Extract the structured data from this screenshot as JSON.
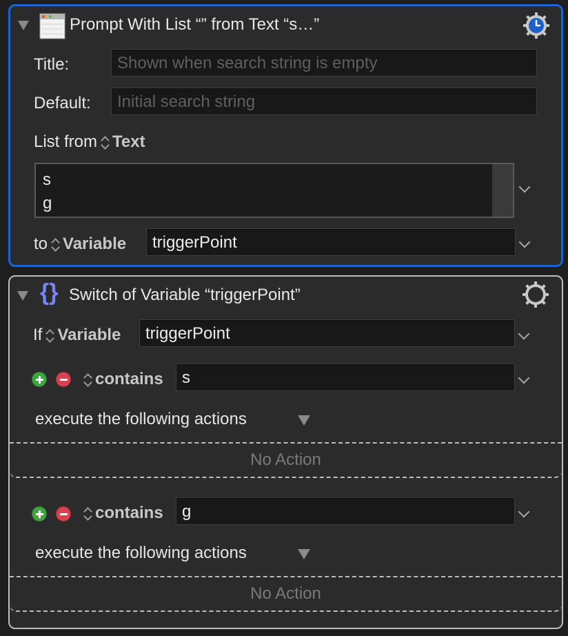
{
  "prompt_action": {
    "title": "Prompt With List “” from Text “s…”",
    "icon": "window-list-icon",
    "gear_icon": "gear-clock-icon",
    "title_label": "Title:",
    "title_placeholder": "Shown when search string is empty",
    "default_label": "Default:",
    "default_placeholder": "Initial search string",
    "list_from_label": "List from",
    "list_from_value": "Text",
    "list_lines": [
      "s",
      "g"
    ],
    "to_label": "to",
    "to_type": "Variable",
    "to_value": "triggerPoint",
    "accent_color": "#1e62d0"
  },
  "switch_action": {
    "title": "Switch of Variable “triggerPoint”",
    "icon": "curly-braces-icon",
    "gear_icon": "gear-icon",
    "if_label": "If",
    "if_type": "Variable",
    "if_value": "triggerPoint",
    "cases": [
      {
        "operator": "contains",
        "value": "s",
        "execute_label": "execute the following actions",
        "empty_label": "No Action"
      },
      {
        "operator": "contains",
        "value": "g",
        "execute_label": "execute the following actions",
        "empty_label": "No Action"
      }
    ]
  }
}
